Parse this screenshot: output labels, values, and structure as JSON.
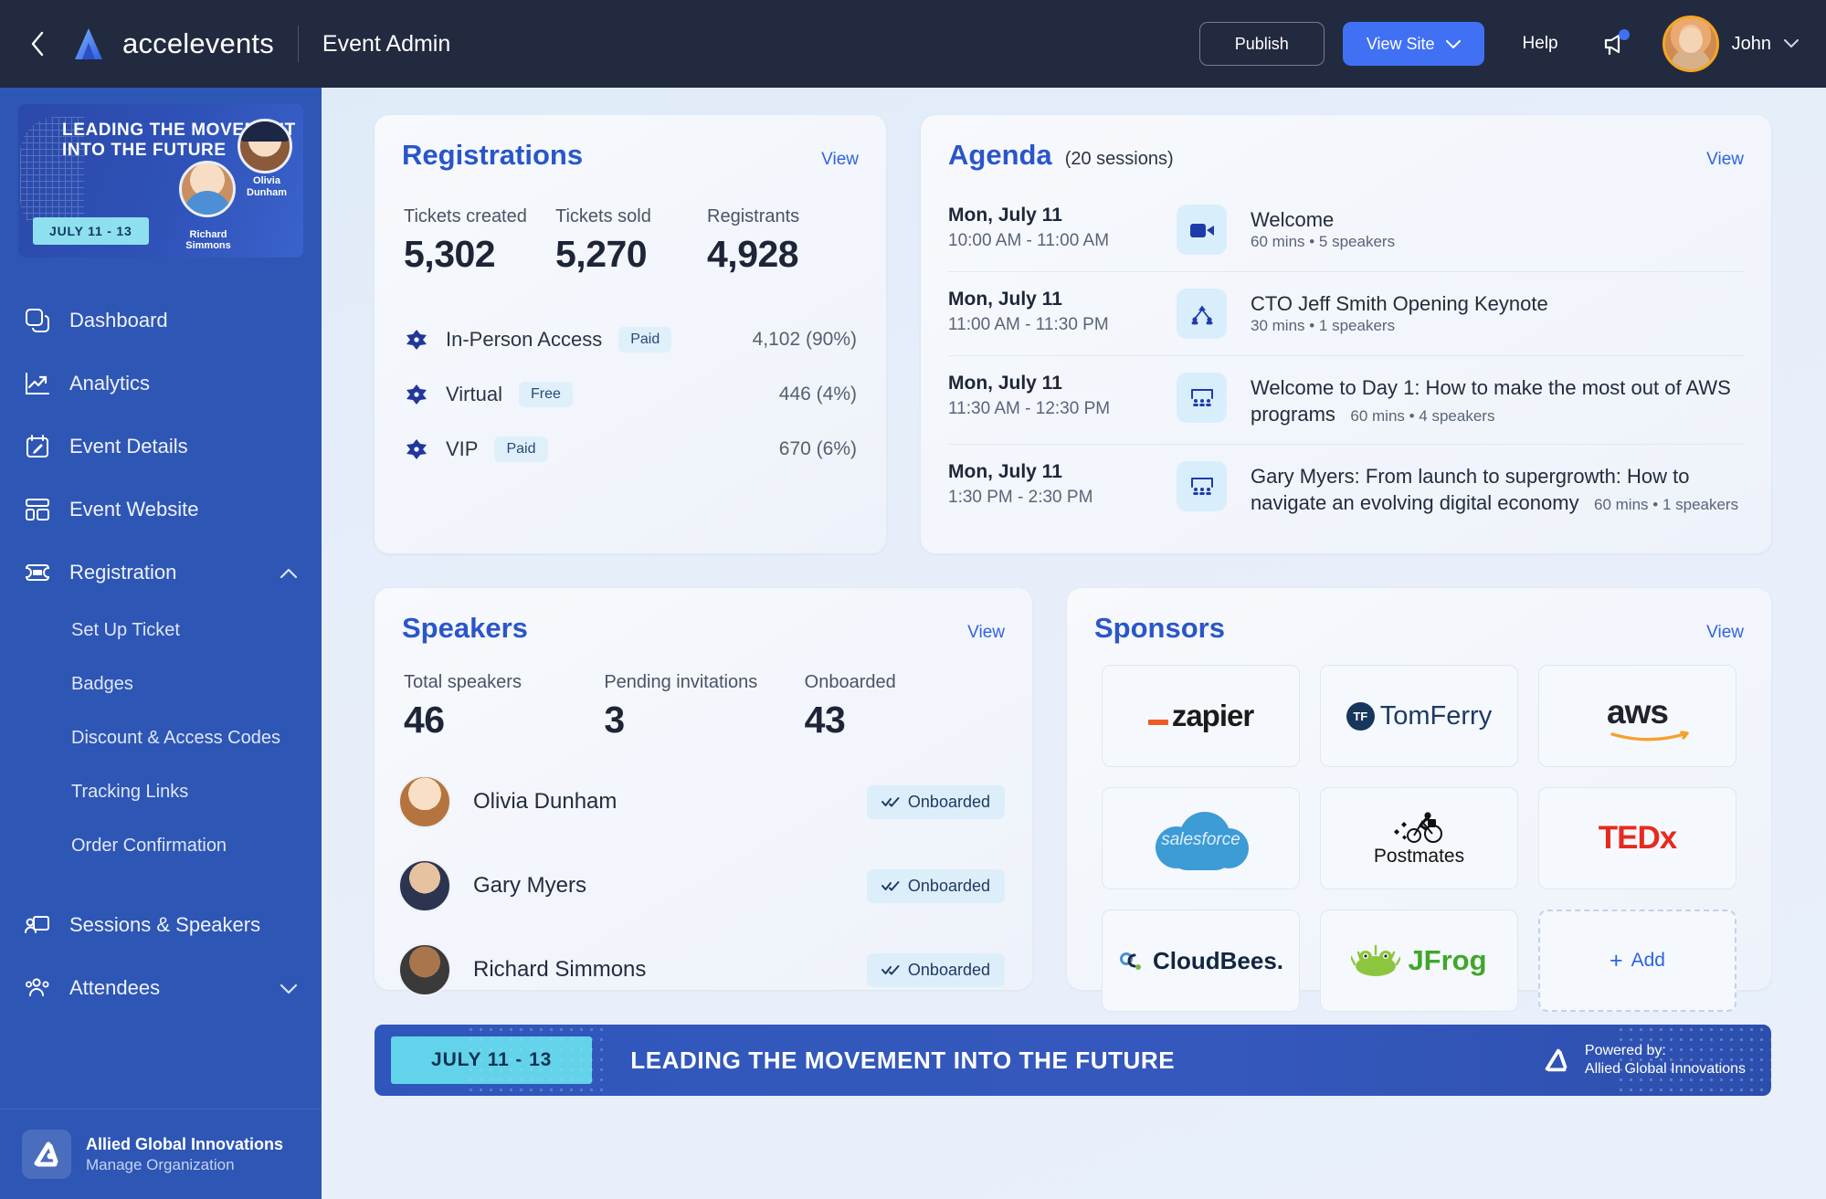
{
  "topbar": {
    "brand": "accelevents",
    "page_title": "Event Admin",
    "publish_label": "Publish",
    "view_site_label": "View Site",
    "help_label": "Help",
    "user_name": "John",
    "accent_color": "#4071f4",
    "bg_color": "#222a3f"
  },
  "sidebar": {
    "banner": {
      "title": "LEADING THE MOVEMENT INTO THE FUTURE",
      "date": "JULY 11 - 13",
      "speaker1": "Richard Simmons",
      "speaker2": "Olivia Dunham"
    },
    "items": [
      {
        "label": "Dashboard",
        "icon": "dashboard-icon"
      },
      {
        "label": "Analytics",
        "icon": "analytics-icon"
      },
      {
        "label": "Event Details",
        "icon": "calendar-edit-icon"
      },
      {
        "label": "Event Website",
        "icon": "layout-icon"
      },
      {
        "label": "Registration",
        "icon": "ticket-icon",
        "expanded": true
      }
    ],
    "registration_sub_items": [
      "Set Up Ticket",
      "Badges",
      "Discount & Access Codes",
      "Tracking Links",
      "Order Confirmation"
    ],
    "items_after": [
      {
        "label": "Sessions & Speakers",
        "icon": "presentation-icon"
      },
      {
        "label": "Attendees",
        "icon": "people-icon",
        "expandable": true
      }
    ],
    "org": {
      "name": "Allied Global Innovations",
      "sub": "Manage Organization"
    },
    "bg_color": "#2e56b4"
  },
  "registrations": {
    "title": "Registrations",
    "view_label": "View",
    "stats": [
      {
        "label": "Tickets created",
        "value": "5,302"
      },
      {
        "label": "Tickets sold",
        "value": "5,270"
      },
      {
        "label": "Registrants",
        "value": "4,928"
      }
    ],
    "tickets": [
      {
        "name": "In-Person Access",
        "pill": "Paid",
        "count": "4,102 (90%)"
      },
      {
        "name": "Virtual",
        "pill": "Free",
        "count": "446 (4%)"
      },
      {
        "name": "VIP",
        "pill": "Paid",
        "count": "670 (6%)"
      }
    ]
  },
  "agenda": {
    "title": "Agenda",
    "subtitle": "(20 sessions)",
    "view_label": "View",
    "sessions": [
      {
        "date": "Mon, July 11",
        "time": "10:00 AM - 11:00 AM",
        "icon": "video-camera-icon",
        "title": "Welcome",
        "meta": "60 mins • 5 speakers",
        "meta_inline": false
      },
      {
        "date": "Mon, July 11",
        "time": "11:00 AM - 11:30 PM",
        "icon": "network-icon",
        "title": "CTO Jeff Smith Opening Keynote",
        "meta": "30 mins • 1 speakers",
        "meta_inline": false
      },
      {
        "date": "Mon, July 11",
        "time": "11:30 AM - 12:30 PM",
        "icon": "audience-icon",
        "title": "Welcome to Day 1: How to make the most out of AWS programs",
        "meta": "60 mins • 4 speakers",
        "meta_inline": true
      },
      {
        "date": "Mon, July 11",
        "time": "1:30 PM - 2:30 PM",
        "icon": "audience-icon",
        "title": "Gary Myers: From launch to supergrowth: How to navigate an evolving digital economy",
        "meta": "60 mins • 1 speakers",
        "meta_inline": true
      }
    ]
  },
  "speakers": {
    "title": "Speakers",
    "view_label": "View",
    "stats": [
      {
        "label": "Total speakers",
        "value": "46"
      },
      {
        "label": "Pending invitations",
        "value": "3"
      },
      {
        "label": "Onboarded",
        "value": "43"
      }
    ],
    "list": [
      {
        "name": "Olivia Dunham",
        "status": "Onboarded"
      },
      {
        "name": "Gary Myers",
        "status": "Onboarded"
      },
      {
        "name": "Richard Simmons",
        "status": "Onboarded"
      }
    ]
  },
  "sponsors": {
    "title": "Sponsors",
    "view_label": "View",
    "add_label": "Add",
    "logos": [
      {
        "name": "zapier"
      },
      {
        "name": "TomFerry"
      },
      {
        "name": "aws"
      },
      {
        "name": "salesforce"
      },
      {
        "name": "Postmates"
      },
      {
        "name": "TEDx"
      },
      {
        "name": "CloudBees."
      },
      {
        "name": "JFrog"
      }
    ]
  },
  "footer_banner": {
    "date": "JULY 11 - 13",
    "title": "LEADING THE MOVEMENT INTO THE FUTURE",
    "powered_label": "Powered by:",
    "powered_org": "Allied Global Innovations"
  }
}
